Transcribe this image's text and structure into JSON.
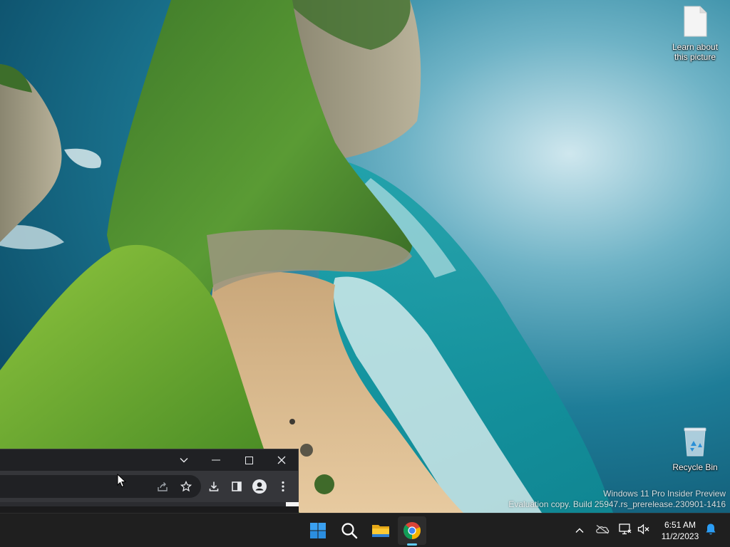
{
  "desktop": {
    "icons": [
      {
        "label": "Learn about this picture",
        "icon": "document-icon"
      },
      {
        "label": "Recycle Bin",
        "icon": "recycle-bin-icon"
      }
    ],
    "watermark": {
      "line1": "Windows 11 Pro Insider Preview",
      "line2": "Evaluation copy. Build 25947.rs_prerelease.230901-1416"
    }
  },
  "chrome_window": {
    "titlebar_buttons": [
      "tab-search-icon",
      "minimize-icon",
      "maximize-icon",
      "close-icon"
    ],
    "toolbar_buttons": [
      "share-icon",
      "bookmark-star-icon",
      "download-icon",
      "side-panel-icon",
      "profile-icon",
      "menu-dots-icon"
    ]
  },
  "taskbar": {
    "apps": [
      "windows-start-icon",
      "search-icon",
      "file-explorer-icon",
      "chrome-icon"
    ],
    "active_app": "chrome-icon",
    "tray": {
      "icons": [
        "chevron-up-icon",
        "onedrive-icon",
        "network-icon",
        "volume-muted-icon",
        "notification-bell-icon"
      ],
      "time": "6:51 AM",
      "date": "11/2/2023"
    }
  },
  "colors": {
    "taskbar_bg": "#1f1f1f",
    "chrome_dark": "#202124",
    "accent": "#60cdff",
    "notification": "#2b9df4"
  }
}
